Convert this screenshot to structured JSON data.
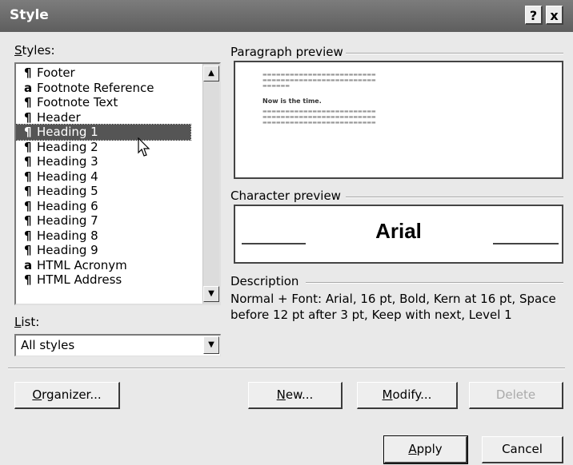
{
  "window": {
    "title": "Style",
    "help_label": "?",
    "close_label": "x"
  },
  "styles": {
    "label_mnemonic": "S",
    "label_rest": "tyles:",
    "items": [
      {
        "glyph": "¶",
        "label": "Footer"
      },
      {
        "glyph": "a",
        "label": "Footnote Reference"
      },
      {
        "glyph": "¶",
        "label": "Footnote Text"
      },
      {
        "glyph": "¶",
        "label": "Header"
      },
      {
        "glyph": "¶",
        "label": "Heading 1"
      },
      {
        "glyph": "¶",
        "label": "Heading 2"
      },
      {
        "glyph": "¶",
        "label": "Heading 3"
      },
      {
        "glyph": "¶",
        "label": "Heading 4"
      },
      {
        "glyph": "¶",
        "label": "Heading 5"
      },
      {
        "glyph": "¶",
        "label": "Heading 6"
      },
      {
        "glyph": "¶",
        "label": "Heading 7"
      },
      {
        "glyph": "¶",
        "label": "Heading 8"
      },
      {
        "glyph": "¶",
        "label": "Heading 9"
      },
      {
        "glyph": "a",
        "label": "HTML Acronym"
      },
      {
        "glyph": "¶",
        "label": "HTML Address"
      }
    ],
    "selected_index": 4
  },
  "list": {
    "label_mnemonic": "L",
    "label_rest": "ist:",
    "value": "All styles"
  },
  "paragraph_preview": {
    "label": "Paragraph preview",
    "sample_text": "Now is the time."
  },
  "character_preview": {
    "label": "Character preview",
    "font_name": "Arial"
  },
  "description": {
    "label": "Description",
    "text": "Normal + Font: Arial, 16 pt, Bold, Kern at 16 pt, Space before 12 pt  after 3 pt, Keep with next, Level 1"
  },
  "buttons": {
    "organizer": {
      "mnemonic": "O",
      "rest": "rganizer..."
    },
    "new": {
      "mnemonic": "N",
      "rest": "ew..."
    },
    "modify": {
      "mnemonic": "M",
      "rest": "odify..."
    },
    "delete": {
      "label": "Delete"
    },
    "apply": {
      "mnemonic": "A",
      "rest": "pply"
    },
    "cancel": {
      "label": "Cancel"
    }
  }
}
